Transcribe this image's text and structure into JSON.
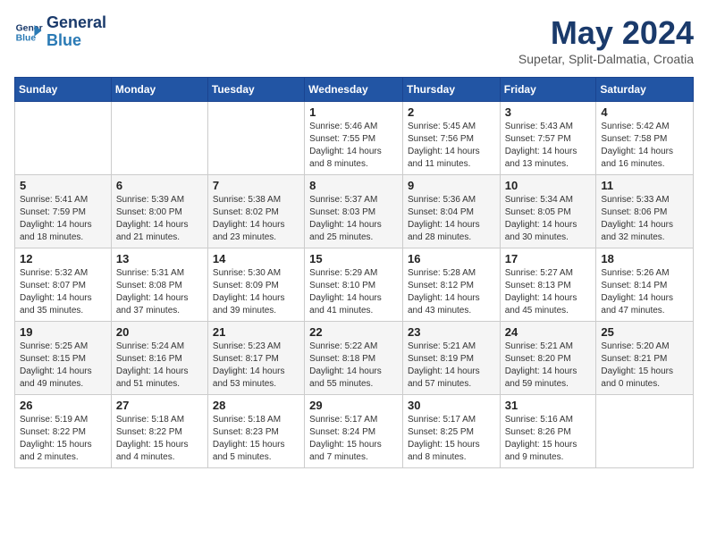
{
  "header": {
    "logo_line1": "General",
    "logo_line2": "Blue",
    "month_title": "May 2024",
    "subtitle": "Supetar, Split-Dalmatia, Croatia"
  },
  "weekdays": [
    "Sunday",
    "Monday",
    "Tuesday",
    "Wednesday",
    "Thursday",
    "Friday",
    "Saturday"
  ],
  "weeks": [
    [
      {
        "date": "",
        "info": ""
      },
      {
        "date": "",
        "info": ""
      },
      {
        "date": "",
        "info": ""
      },
      {
        "date": "1",
        "info": "Sunrise: 5:46 AM\nSunset: 7:55 PM\nDaylight: 14 hours\nand 8 minutes."
      },
      {
        "date": "2",
        "info": "Sunrise: 5:45 AM\nSunset: 7:56 PM\nDaylight: 14 hours\nand 11 minutes."
      },
      {
        "date": "3",
        "info": "Sunrise: 5:43 AM\nSunset: 7:57 PM\nDaylight: 14 hours\nand 13 minutes."
      },
      {
        "date": "4",
        "info": "Sunrise: 5:42 AM\nSunset: 7:58 PM\nDaylight: 14 hours\nand 16 minutes."
      }
    ],
    [
      {
        "date": "5",
        "info": "Sunrise: 5:41 AM\nSunset: 7:59 PM\nDaylight: 14 hours\nand 18 minutes."
      },
      {
        "date": "6",
        "info": "Sunrise: 5:39 AM\nSunset: 8:00 PM\nDaylight: 14 hours\nand 21 minutes."
      },
      {
        "date": "7",
        "info": "Sunrise: 5:38 AM\nSunset: 8:02 PM\nDaylight: 14 hours\nand 23 minutes."
      },
      {
        "date": "8",
        "info": "Sunrise: 5:37 AM\nSunset: 8:03 PM\nDaylight: 14 hours\nand 25 minutes."
      },
      {
        "date": "9",
        "info": "Sunrise: 5:36 AM\nSunset: 8:04 PM\nDaylight: 14 hours\nand 28 minutes."
      },
      {
        "date": "10",
        "info": "Sunrise: 5:34 AM\nSunset: 8:05 PM\nDaylight: 14 hours\nand 30 minutes."
      },
      {
        "date": "11",
        "info": "Sunrise: 5:33 AM\nSunset: 8:06 PM\nDaylight: 14 hours\nand 32 minutes."
      }
    ],
    [
      {
        "date": "12",
        "info": "Sunrise: 5:32 AM\nSunset: 8:07 PM\nDaylight: 14 hours\nand 35 minutes."
      },
      {
        "date": "13",
        "info": "Sunrise: 5:31 AM\nSunset: 8:08 PM\nDaylight: 14 hours\nand 37 minutes."
      },
      {
        "date": "14",
        "info": "Sunrise: 5:30 AM\nSunset: 8:09 PM\nDaylight: 14 hours\nand 39 minutes."
      },
      {
        "date": "15",
        "info": "Sunrise: 5:29 AM\nSunset: 8:10 PM\nDaylight: 14 hours\nand 41 minutes."
      },
      {
        "date": "16",
        "info": "Sunrise: 5:28 AM\nSunset: 8:12 PM\nDaylight: 14 hours\nand 43 minutes."
      },
      {
        "date": "17",
        "info": "Sunrise: 5:27 AM\nSunset: 8:13 PM\nDaylight: 14 hours\nand 45 minutes."
      },
      {
        "date": "18",
        "info": "Sunrise: 5:26 AM\nSunset: 8:14 PM\nDaylight: 14 hours\nand 47 minutes."
      }
    ],
    [
      {
        "date": "19",
        "info": "Sunrise: 5:25 AM\nSunset: 8:15 PM\nDaylight: 14 hours\nand 49 minutes."
      },
      {
        "date": "20",
        "info": "Sunrise: 5:24 AM\nSunset: 8:16 PM\nDaylight: 14 hours\nand 51 minutes."
      },
      {
        "date": "21",
        "info": "Sunrise: 5:23 AM\nSunset: 8:17 PM\nDaylight: 14 hours\nand 53 minutes."
      },
      {
        "date": "22",
        "info": "Sunrise: 5:22 AM\nSunset: 8:18 PM\nDaylight: 14 hours\nand 55 minutes."
      },
      {
        "date": "23",
        "info": "Sunrise: 5:21 AM\nSunset: 8:19 PM\nDaylight: 14 hours\nand 57 minutes."
      },
      {
        "date": "24",
        "info": "Sunrise: 5:21 AM\nSunset: 8:20 PM\nDaylight: 14 hours\nand 59 minutes."
      },
      {
        "date": "25",
        "info": "Sunrise: 5:20 AM\nSunset: 8:21 PM\nDaylight: 15 hours\nand 0 minutes."
      }
    ],
    [
      {
        "date": "26",
        "info": "Sunrise: 5:19 AM\nSunset: 8:22 PM\nDaylight: 15 hours\nand 2 minutes."
      },
      {
        "date": "27",
        "info": "Sunrise: 5:18 AM\nSunset: 8:22 PM\nDaylight: 15 hours\nand 4 minutes."
      },
      {
        "date": "28",
        "info": "Sunrise: 5:18 AM\nSunset: 8:23 PM\nDaylight: 15 hours\nand 5 minutes."
      },
      {
        "date": "29",
        "info": "Sunrise: 5:17 AM\nSunset: 8:24 PM\nDaylight: 15 hours\nand 7 minutes."
      },
      {
        "date": "30",
        "info": "Sunrise: 5:17 AM\nSunset: 8:25 PM\nDaylight: 15 hours\nand 8 minutes."
      },
      {
        "date": "31",
        "info": "Sunrise: 5:16 AM\nSunset: 8:26 PM\nDaylight: 15 hours\nand 9 minutes."
      },
      {
        "date": "",
        "info": ""
      }
    ]
  ]
}
